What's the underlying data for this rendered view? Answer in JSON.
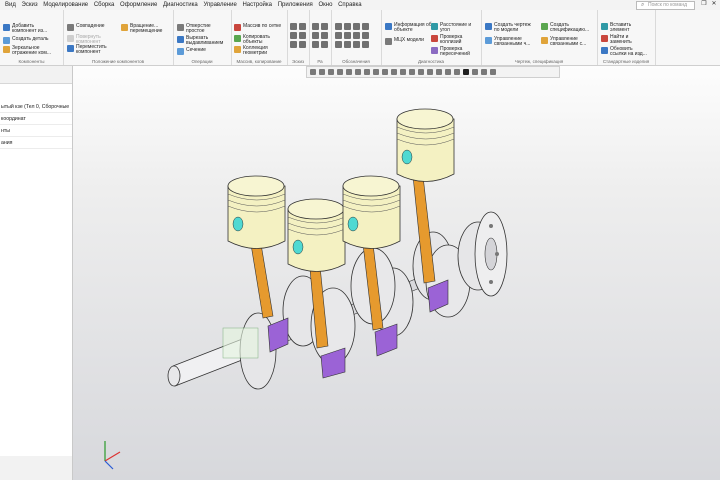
{
  "menu": [
    "Вид",
    "Эскиз",
    "Моделирование",
    "Сборка",
    "Оформление",
    "Диагностика",
    "Управление",
    "Настройка",
    "Приложения",
    "Окно",
    "Справка"
  ],
  "search_placeholder": "Поиск по команд",
  "ribbon": {
    "components": {
      "title": "Компоненты",
      "buttons": [
        "Добавить\nкомпонент из...",
        "Создать деталь",
        "Зеркальное\nотражение ком..."
      ]
    },
    "position": {
      "title": "Положение компонентов",
      "buttons": [
        "Совпадение",
        "Переместить\nкомпонент",
        "Повернуть\nкомпонент",
        "Вращение...\nперемещение"
      ]
    },
    "operations": {
      "title": "Операции",
      "buttons": [
        "Отверстие\nпростое",
        "Вырезать\nвыдавливанием",
        "Сечение"
      ]
    },
    "copy": {
      "title": "Массив, копирование",
      "buttons": [
        "Массив по сетке",
        "Копировать\nобъекты",
        "Коллекция\nгеометрии"
      ]
    },
    "small_titles": [
      "Эскиз",
      "Ра",
      "Обозначения"
    ],
    "diagnostics": {
      "title": "Диагностика",
      "buttons": [
        "Информация об\nобъекте",
        "МЦХ модели",
        "Расстояние и\nугол",
        "Проверка\nколлизий",
        "Проверка\nпересечений"
      ]
    },
    "drawing": {
      "title": "Чертеж, спецификация",
      "buttons": [
        "Создать чертеж\nпо модели",
        "Управление\nсвязанными ч...",
        "Создать\nспецификацию...",
        "Управление\nсвязанными с..."
      ]
    },
    "standard": {
      "title": "Стандартные изделия",
      "buttons": [
        "Вставить\nэлемент",
        "Найти и\nзаменить",
        "Обновить\nссылки на изд..."
      ]
    }
  },
  "tree": {
    "rows": [
      "ытый кзе (Тел 0, Сборочные",
      "координат",
      "нты",
      "ания"
    ]
  },
  "colors": {
    "piston": "#f4f1c2",
    "rod": "#e69a2e",
    "cap": "#9b63d6",
    "crank": "#e6e6e8",
    "pin_hole": "#4fd9d2"
  }
}
